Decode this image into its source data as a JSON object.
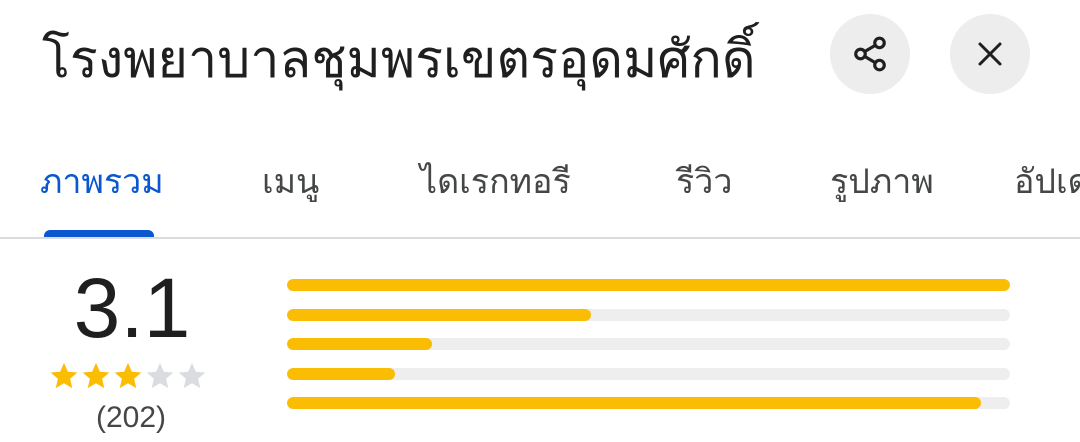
{
  "place": {
    "title": "โรงพยาบาลชุมพรเขตรอุดมศักดิ์"
  },
  "actions": {
    "share_icon": "share-icon",
    "close_icon": "close-icon"
  },
  "tabs": [
    {
      "label": "ภาพรวม",
      "active": true
    },
    {
      "label": "เมนู",
      "active": false
    },
    {
      "label": "ไดเรกทอรี",
      "active": false
    },
    {
      "label": "รีวิว",
      "active": false
    },
    {
      "label": "รูปภาพ",
      "active": false
    },
    {
      "label": "อัปเดต",
      "active": false
    }
  ],
  "rating": {
    "value": "3.1",
    "stars_filled": 3,
    "stars_total": 5,
    "count": "(202)"
  },
  "histogram": [
    {
      "stars": 5,
      "fraction": 1.0
    },
    {
      "stars": 4,
      "fraction": 0.42
    },
    {
      "stars": 3,
      "fraction": 0.2
    },
    {
      "stars": 2,
      "fraction": 0.15
    },
    {
      "stars": 1,
      "fraction": 0.96
    }
  ],
  "colors": {
    "accent": "#0b57d0",
    "star": "#fbbc04",
    "star_empty": "#dadce0",
    "bar_track": "#eeeeee",
    "button_bg": "#ededed"
  }
}
